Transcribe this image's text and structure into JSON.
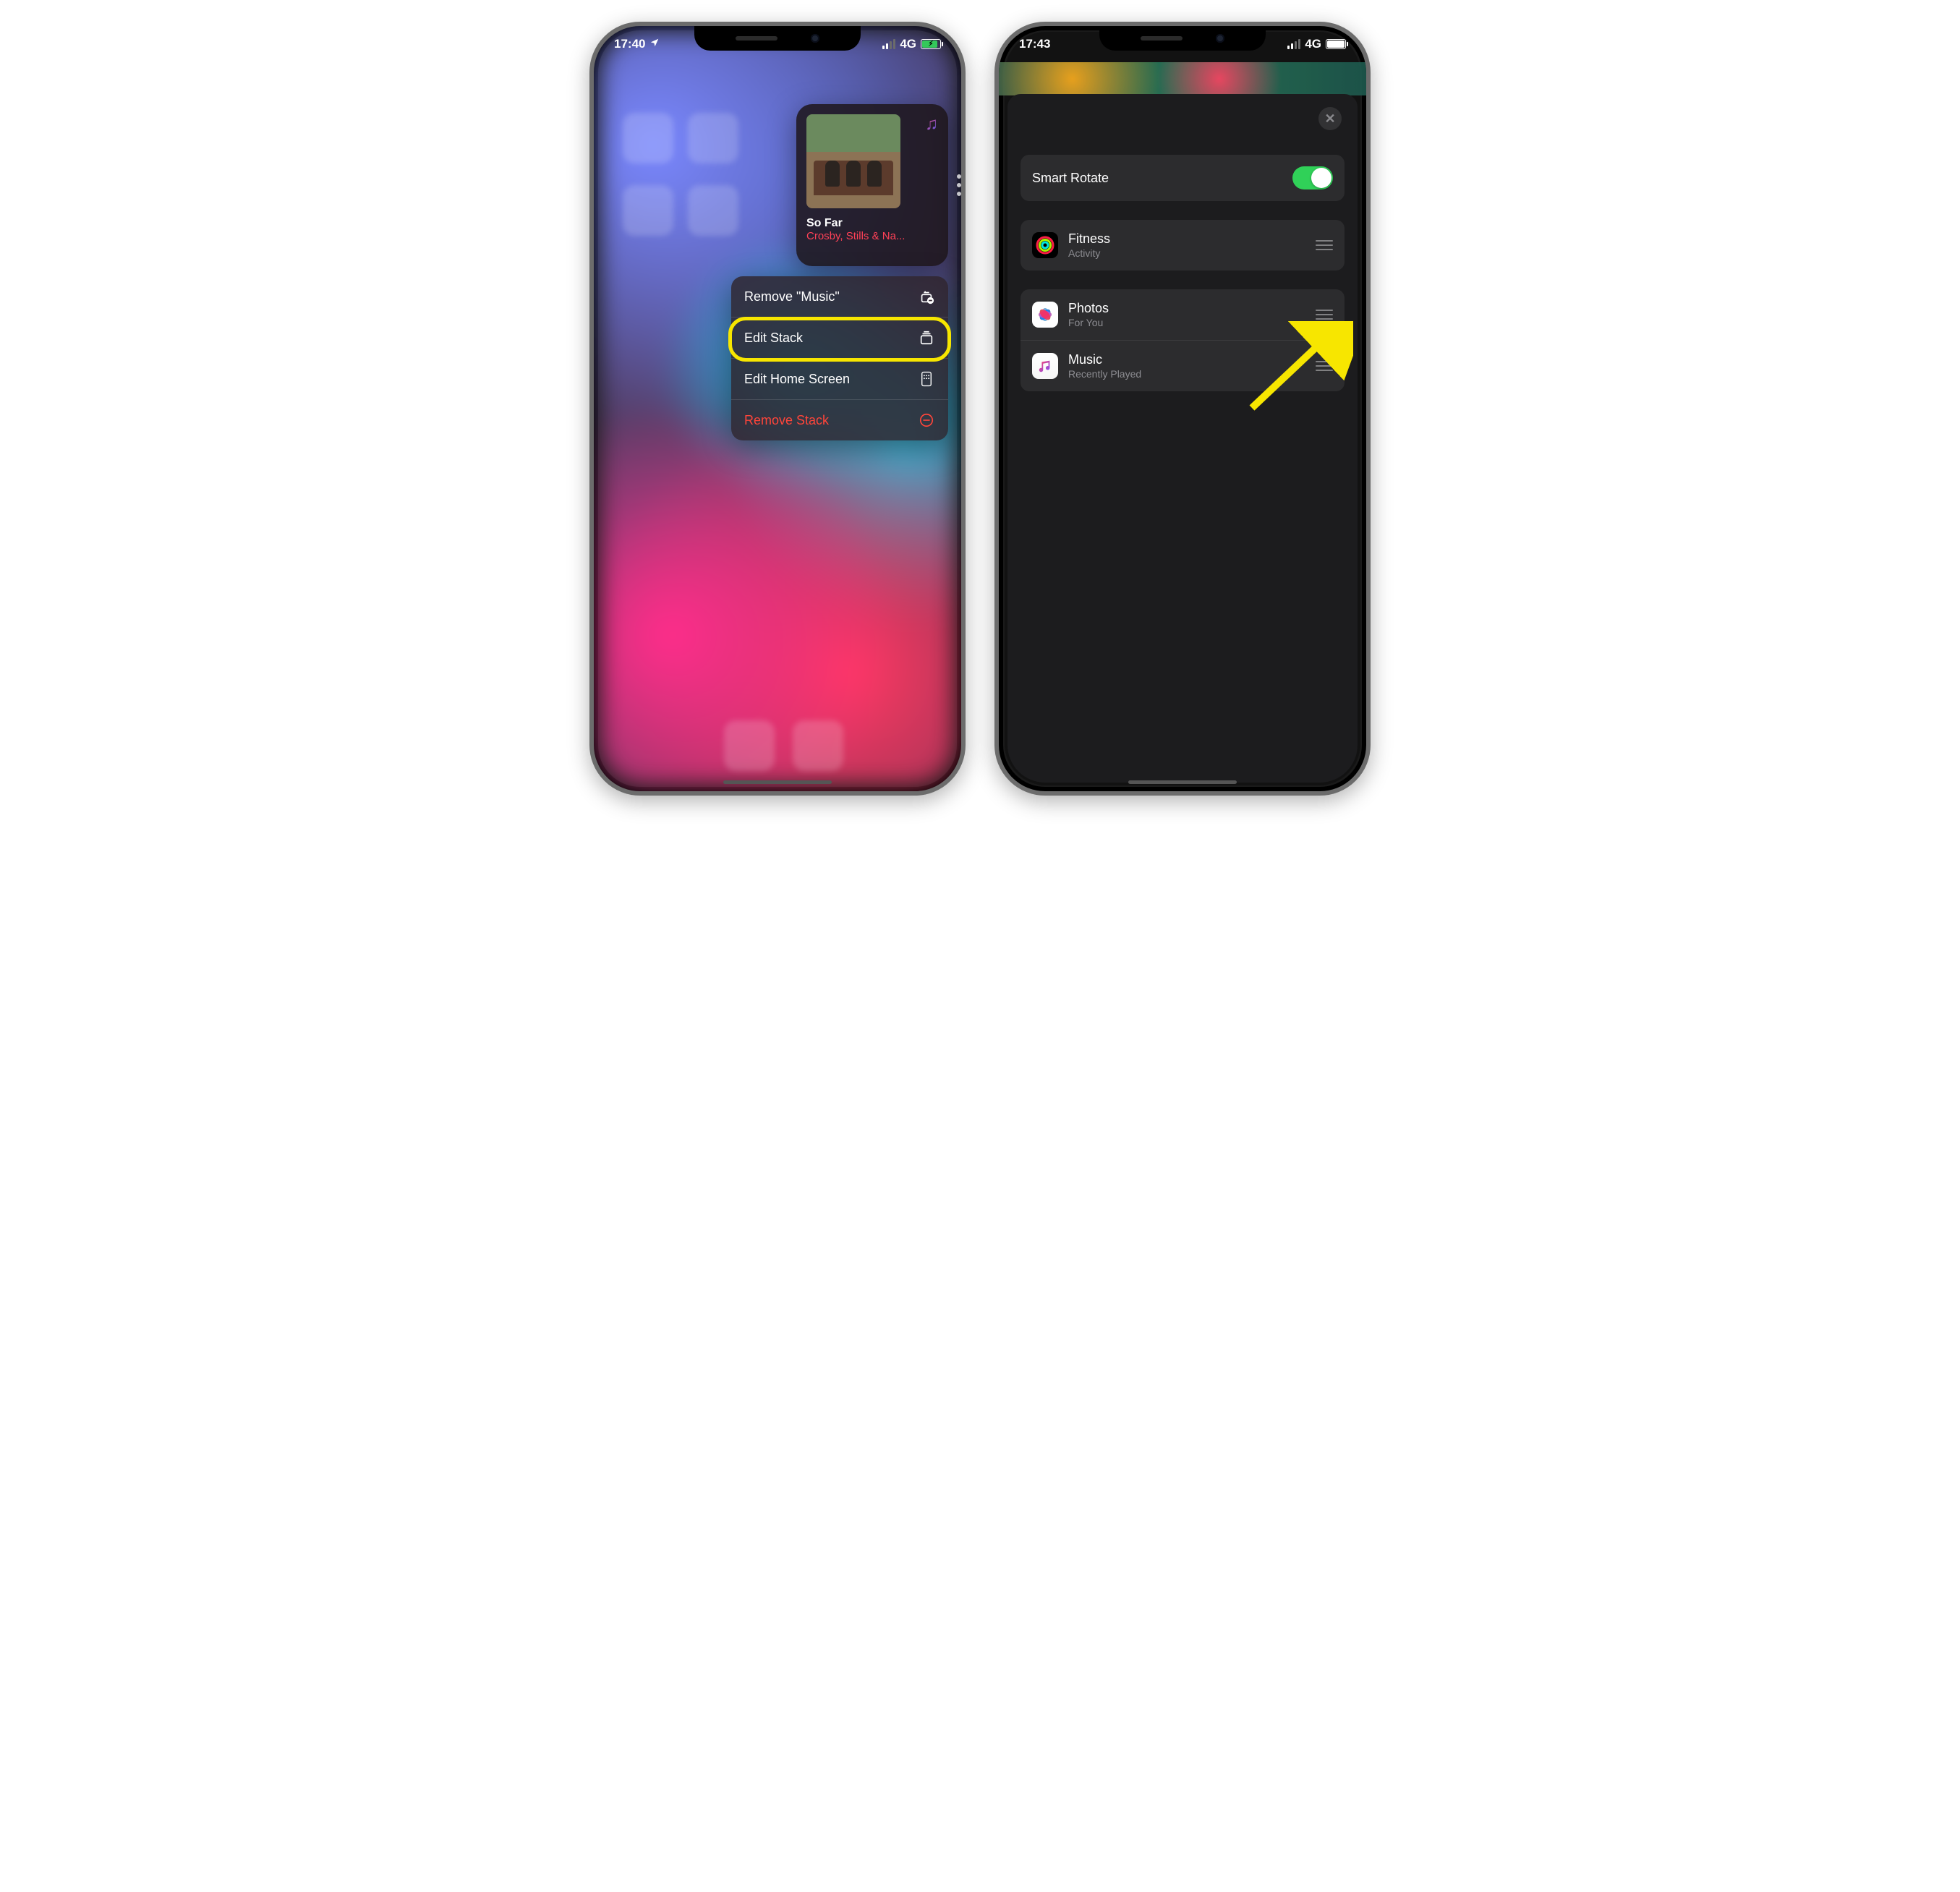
{
  "left": {
    "status": {
      "time": "17:40",
      "network": "4G"
    },
    "widget": {
      "track_title": "So Far",
      "track_artist": "Crosby, Stills & Na..."
    },
    "menu": {
      "remove_app": "Remove \"Music\"",
      "edit_stack": "Edit Stack",
      "edit_home": "Edit Home Screen",
      "remove_stack": "Remove Stack"
    }
  },
  "right": {
    "status": {
      "time": "17:43",
      "network": "4G"
    },
    "smart_rotate_label": "Smart Rotate",
    "smart_rotate_on": true,
    "items": [
      {
        "name": "Fitness",
        "sub": "Activity"
      },
      {
        "name": "Photos",
        "sub": "For You"
      },
      {
        "name": "Music",
        "sub": "Recently Played"
      }
    ]
  }
}
